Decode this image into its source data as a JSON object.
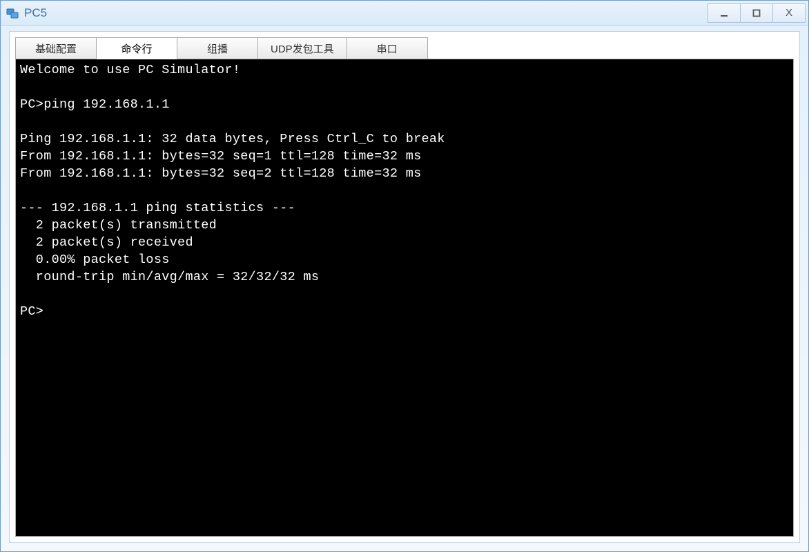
{
  "window": {
    "title": "PC5",
    "controls": {
      "minimize": "—",
      "maximize": "□",
      "close": "X"
    }
  },
  "tabs": [
    {
      "id": "basic-config",
      "label": "基础配置",
      "active": false
    },
    {
      "id": "command-line",
      "label": "命令行",
      "active": true
    },
    {
      "id": "multicast",
      "label": "组播",
      "active": false
    },
    {
      "id": "udp-tool",
      "label": "UDP发包工具",
      "active": false
    },
    {
      "id": "serial",
      "label": "串口",
      "active": false
    }
  ],
  "terminal": {
    "lines": [
      "Welcome to use PC Simulator!",
      "",
      "PC>ping 192.168.1.1",
      "",
      "Ping 192.168.1.1: 32 data bytes, Press Ctrl_C to break",
      "From 192.168.1.1: bytes=32 seq=1 ttl=128 time=32 ms",
      "From 192.168.1.1: bytes=32 seq=2 ttl=128 time=32 ms",
      "",
      "--- 192.168.1.1 ping statistics ---",
      "  2 packet(s) transmitted",
      "  2 packet(s) received",
      "  0.00% packet loss",
      "  round-trip min/avg/max = 32/32/32 ms",
      "",
      "PC>"
    ]
  }
}
